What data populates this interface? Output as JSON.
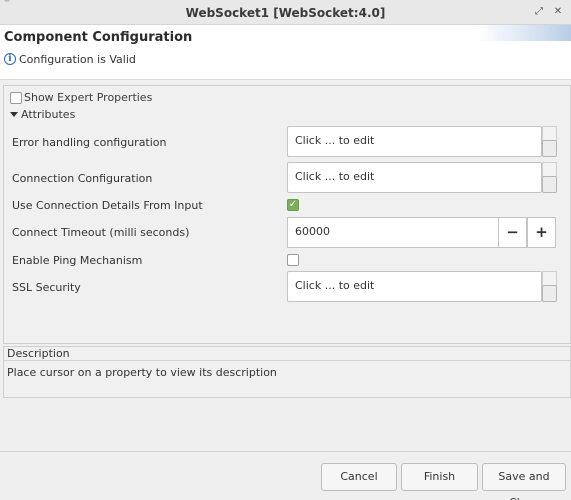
{
  "window": {
    "title": "WebSocket1 [WebSocket:4.0]",
    "restore_glyph": "⤢",
    "close_glyph": "✕"
  },
  "header": {
    "heading": "Component Configuration",
    "status_icon": "info-icon",
    "status_icon_glyph": "i",
    "status_text": "Configuration is Valid"
  },
  "properties": {
    "show_expert_label": "Show Expert Properties",
    "show_expert_checked": false,
    "attributes_label": "Attributes",
    "rows": {
      "error_handling": {
        "label": "Error handling configuration",
        "value": "Click ... to edit"
      },
      "connection_config": {
        "label": "Connection Configuration",
        "value": "Click ... to edit"
      },
      "use_connection_details": {
        "label": "Use Connection Details From Input",
        "checked": true,
        "check_glyph": "✓"
      },
      "connect_timeout": {
        "label": "Connect Timeout (milli seconds)",
        "value": "60000",
        "minus": "−",
        "plus": "+"
      },
      "enable_ping": {
        "label": "Enable Ping Mechanism",
        "checked": false
      },
      "ssl_security": {
        "label": "SSL Security",
        "value": "Click ... to edit"
      }
    }
  },
  "description": {
    "heading": "Description",
    "text": "Place cursor on a property to view its description"
  },
  "buttons": {
    "cancel": "Cancel",
    "finish": "Finish",
    "save_close": "Save and Close"
  },
  "colors": {
    "accent": "#2a6ab3",
    "checked": "#7eae5a"
  }
}
